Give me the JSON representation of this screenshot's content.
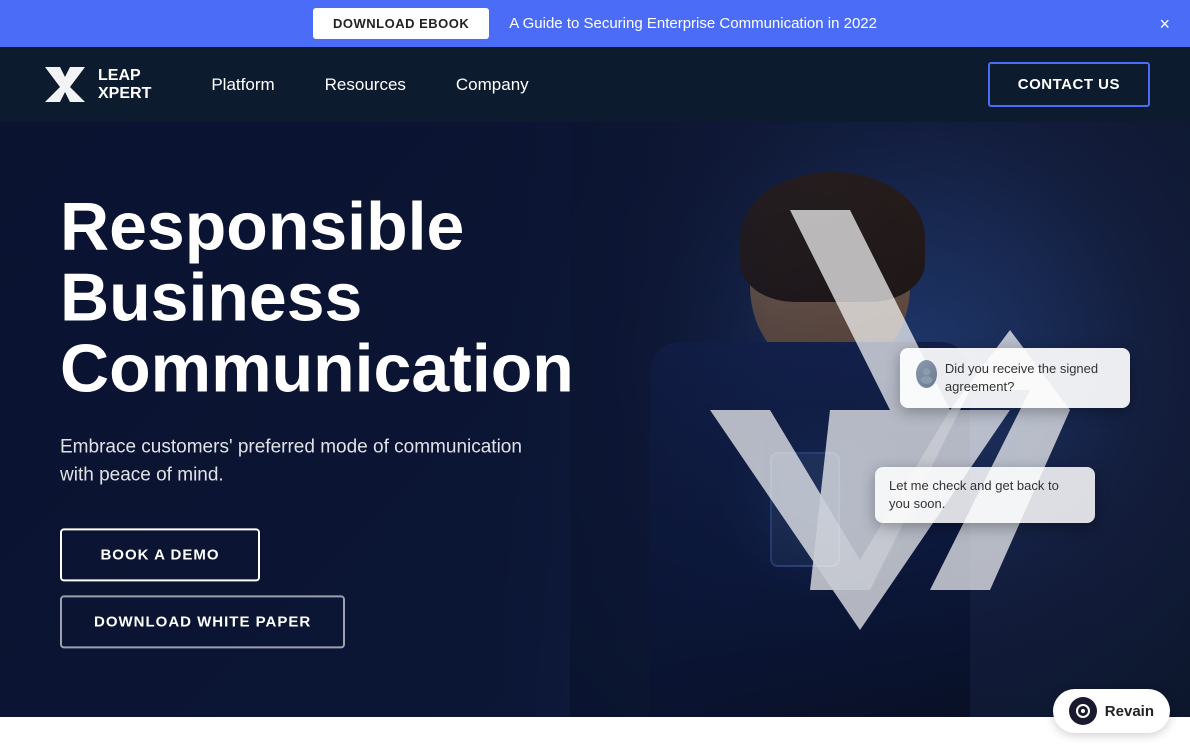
{
  "banner": {
    "download_label": "DOWNLOAD EBOOK",
    "text": "A Guide to Securing Enterprise Communication in 2022",
    "close_symbol": "×"
  },
  "navbar": {
    "logo_text": "LEAP XPERT",
    "links": [
      {
        "label": "Platform",
        "id": "platform"
      },
      {
        "label": "Resources",
        "id": "resources"
      },
      {
        "label": "Company",
        "id": "company"
      }
    ],
    "contact_label": "CONTACT US"
  },
  "hero": {
    "title_line1": "Responsible",
    "title_line2": "Business",
    "title_line3": "Communication",
    "subtitle": "Embrace customers' preferred mode of communication with peace of mind.",
    "btn_demo": "BOOK A DEMO",
    "btn_whitepaper": "DOWNLOAD WHITE PAPER",
    "chat1": {
      "text": "Did you receive the signed agreement?"
    },
    "chat2": {
      "text": "Let me check and get back to you soon."
    }
  },
  "revain": {
    "label": "Revain"
  }
}
